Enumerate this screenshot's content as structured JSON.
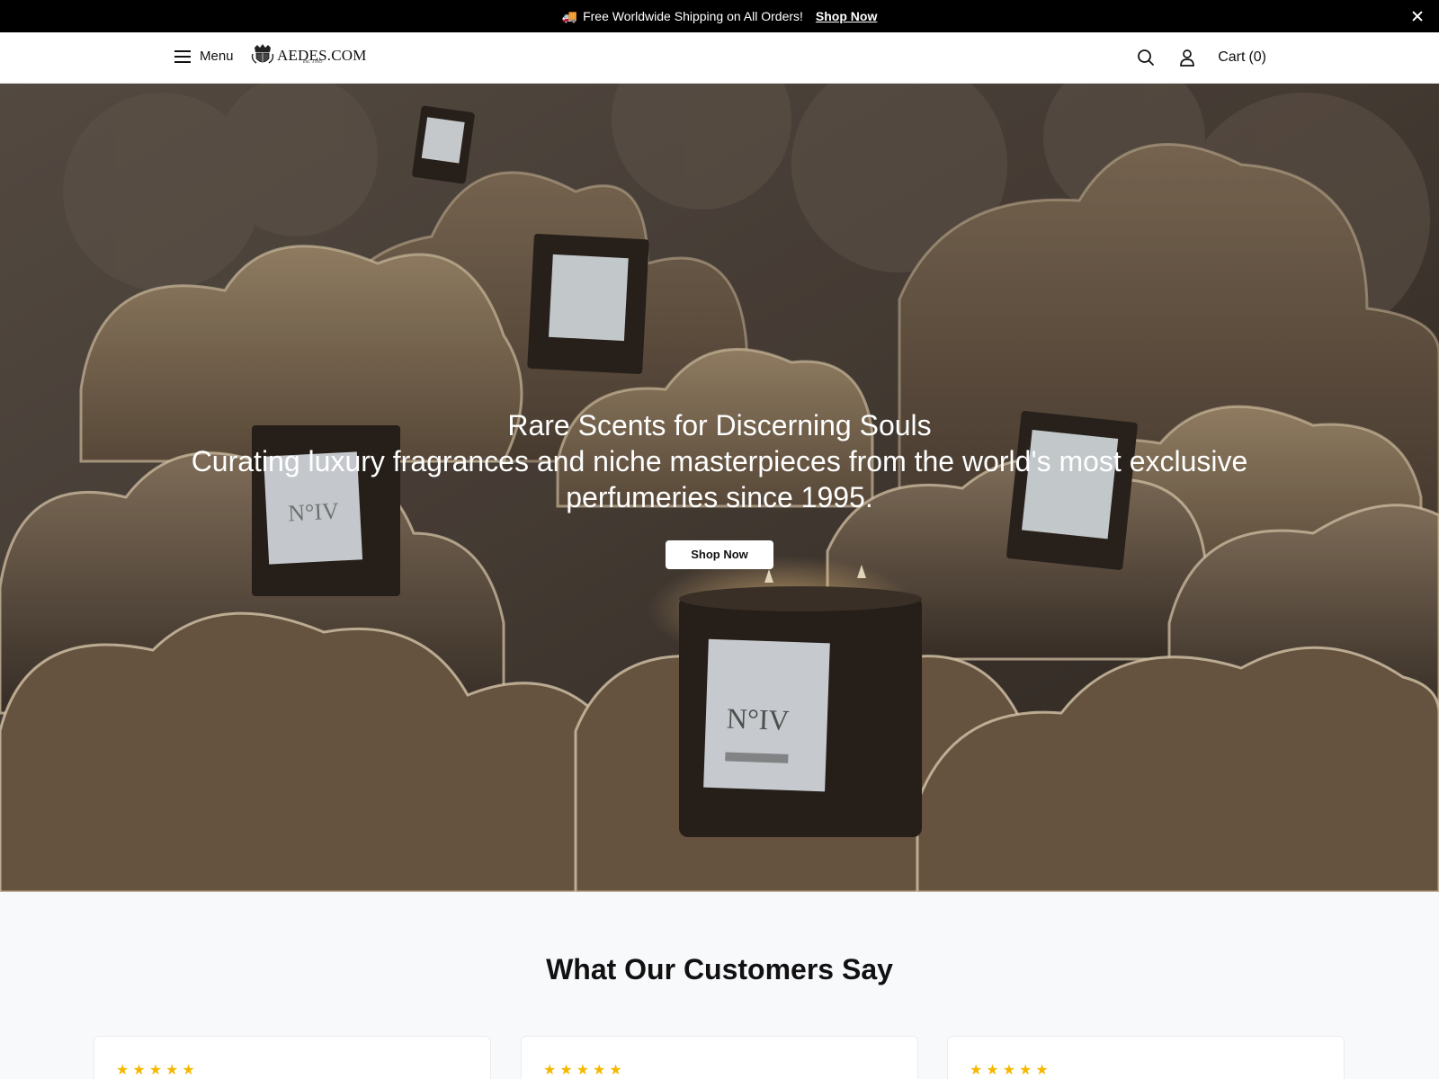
{
  "announcement": {
    "icon": "truck-icon",
    "emoji": "🚚",
    "message": "Free Worldwide Shipping on All Orders!",
    "link_label": "Shop Now"
  },
  "header": {
    "menu_label": "Menu",
    "logo_text": "AEDES.COM",
    "logo_estab": "est. 1995",
    "cart_label": "Cart",
    "cart_count": "(0)"
  },
  "hero": {
    "title": "Rare Scents for Discerning Souls",
    "subtitle": "Curating luxury fragrances and niche masterpieces from the world's most exclusive perfumeries since 1995.",
    "button_label": "Shop Now",
    "candle_label": "N°IV"
  },
  "testimonials": {
    "title": "What Our Customers Say",
    "cards": [
      {
        "stars": "★★★★★",
        "rating": 5
      },
      {
        "stars": "★★★★★",
        "rating": 5
      },
      {
        "stars": "★★★★★",
        "rating": 5
      }
    ]
  },
  "colors": {
    "announcement_bg": "#000000",
    "star": "#f5b800",
    "hero_tone": "#3e352e"
  }
}
